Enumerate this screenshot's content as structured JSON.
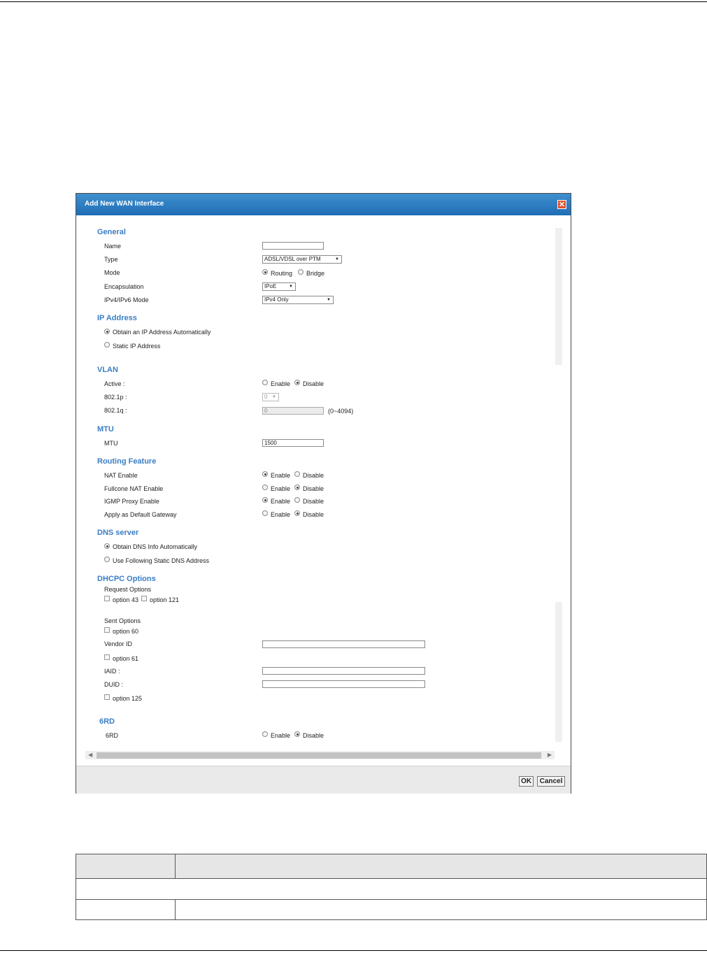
{
  "dialog": {
    "title": "Add New WAN Interface",
    "close_icon": "close-icon",
    "ok_label": "OK",
    "cancel_label": "Cancel"
  },
  "general": {
    "heading": "General",
    "name_label": "Name",
    "name_value": "",
    "type_label": "Type",
    "type_value": "ADSL/VDSL over PTM",
    "mode_label": "Mode",
    "mode_routing": "Routing",
    "mode_bridge": "Bridge",
    "mode_selected": "Routing",
    "encap_label": "Encapsulation",
    "encap_value": "IPoE",
    "ipmode_label": "IPv4/IPv6 Mode",
    "ipmode_value": "IPv4 Only"
  },
  "ip_address": {
    "heading": "IP Address",
    "auto_label": "Obtain an IP Address Automatically",
    "static_label": "Static IP Address",
    "selected": "auto"
  },
  "vlan": {
    "heading": "VLAN",
    "active_label": "Active :",
    "enable": "Enable",
    "disable": "Disable",
    "selected": "Disable",
    "p8021_label": "802.1p :",
    "p8021_value": "0",
    "q8021_label": "802.1q :",
    "q8021_value": "0",
    "q8021_range": "(0~4094)"
  },
  "mtu": {
    "heading": "MTU",
    "label": "MTU",
    "value": "1500"
  },
  "routing": {
    "heading": "Routing Feature",
    "enable": "Enable",
    "disable": "Disable",
    "rows": [
      {
        "label": "NAT Enable",
        "selected": "Enable"
      },
      {
        "label": "Fullcone NAT Enable",
        "selected": "Disable"
      },
      {
        "label": "IGMP Proxy Enable",
        "selected": "Enable"
      },
      {
        "label": "Apply as Default Gateway",
        "selected": "Disable"
      }
    ]
  },
  "dns": {
    "heading": "DNS server",
    "auto_label": "Obtain DNS Info Automatically",
    "static_label": "Use Following Static DNS Address",
    "selected": "auto"
  },
  "dhcpc": {
    "heading": "DHCPC Options",
    "request_label": "Request Options",
    "opt43": "option 43",
    "opt121": "option 121",
    "sent_label": "Sent Options",
    "opt60": "option 60",
    "vendor_label": "Vendor ID",
    "vendor_value": "",
    "opt61": "option 61",
    "iaid_label": "IAID :",
    "iaid_value": "",
    "duid_label": "DUID :",
    "duid_value": "",
    "opt125": "option 125"
  },
  "sixrd": {
    "heading": "6RD",
    "label": "6RD",
    "enable": "Enable",
    "disable": "Disable",
    "selected": "Disable"
  },
  "colors": {
    "title_bar": "#2a7cc2",
    "section_heading": "#3a7dc4",
    "close_button": "#e0502c"
  }
}
